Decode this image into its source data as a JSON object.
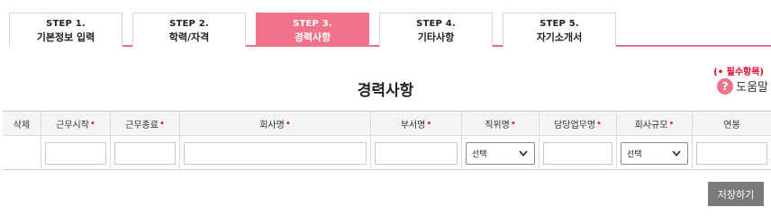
{
  "steps": [
    {
      "num": "STEP 1.",
      "label": "기본정보 입력"
    },
    {
      "num": "STEP 2.",
      "label": "학력/자격"
    },
    {
      "num": "STEP 3.",
      "label": "경력사항"
    },
    {
      "num": "STEP 4.",
      "label": "기타사항"
    },
    {
      "num": "STEP 5.",
      "label": "자기소개서"
    }
  ],
  "active_step": 3,
  "accent_color": "#f07389",
  "title": "경력사항",
  "required_note": "(• 필수항목)",
  "help": {
    "icon": "?",
    "label": "도움말"
  },
  "table": {
    "columns": [
      {
        "label": "삭제",
        "required": false
      },
      {
        "label": "근무시작",
        "required": true
      },
      {
        "label": "근무종료",
        "required": true
      },
      {
        "label": "회사명",
        "required": true
      },
      {
        "label": "부서명",
        "required": true
      },
      {
        "label": "직위명",
        "required": true
      },
      {
        "label": "담당업무명",
        "required": true
      },
      {
        "label": "회사규모",
        "required": true
      },
      {
        "label": "연봉",
        "required": false
      }
    ],
    "required_mark": "•",
    "row": {
      "start_date": "",
      "end_date": "",
      "company": "",
      "department": "",
      "position_select": "선택",
      "duty": "",
      "company_size_select": "선택",
      "salary": ""
    }
  },
  "save_label": "저장하기"
}
